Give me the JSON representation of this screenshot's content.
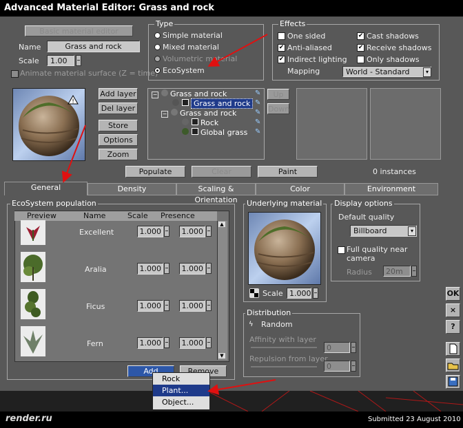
{
  "title": "Advanced Material Editor: Grass and rock",
  "basic_editor_label": "Basic material editor",
  "name_label": "Name",
  "name_value": "Grass and rock",
  "scale_label": "Scale",
  "scale_value": "1.00",
  "animate_label": "Animate material surface (Z = time)",
  "type": {
    "title": "Type",
    "options": [
      "Simple material",
      "Mixed material",
      "Volumetric material",
      "EcoSystem"
    ],
    "selected": 3
  },
  "effects": {
    "title": "Effects",
    "left": [
      "One sided",
      "Anti-aliased",
      "Indirect lighting"
    ],
    "left_checked": [
      true,
      true,
      true
    ],
    "right": [
      "Cast shadows",
      "Receive shadows",
      "Only shadows"
    ],
    "right_checked": [
      true,
      true,
      false
    ],
    "mapping_label": "Mapping",
    "mapping_value": "World - Standard"
  },
  "layer_buttons": [
    "Add layer",
    "Del layer",
    "Store",
    "Options",
    "Zoom"
  ],
  "tree": [
    "Grass and rock",
    "Grass and rock",
    "Grass and rock",
    "Rock",
    "Global grass"
  ],
  "up_label": "Up",
  "down_label": "Down",
  "populate_label": "Populate",
  "clear_label": "Clear",
  "paint_label": "Paint",
  "instances": "0 instances",
  "tabs": [
    "General",
    "Density",
    "Scaling & Orientation",
    "Color",
    "Environment"
  ],
  "eco": {
    "title": "EcoSystem population",
    "headers": [
      "Preview",
      "Name",
      "Scale",
      "Presence"
    ],
    "rows": [
      {
        "name": "Excellent",
        "scale": "1.000",
        "presence": "1.000"
      },
      {
        "name": "Aralia",
        "scale": "1.000",
        "presence": "1.000"
      },
      {
        "name": "Ficus",
        "scale": "1.000",
        "presence": "1.000"
      },
      {
        "name": "Fern",
        "scale": "1.000",
        "presence": "1.000"
      }
    ],
    "add_label": "Add",
    "remove_label": "Remove"
  },
  "underlying": {
    "title": "Underlying material",
    "scale_label": "Scale",
    "scale_value": "1.000"
  },
  "display": {
    "title": "Display options",
    "quality_label": "Default quality",
    "quality_value": "Billboard",
    "full_quality": "Full quality near camera",
    "radius_label": "Radius",
    "radius_value": "20m"
  },
  "distribution": {
    "title": "Distribution",
    "mode": "Random",
    "affinity_label": "Affinity with layer",
    "affinity_value": "0",
    "repulsion_label": "Repulsion from layer",
    "repulsion_value": "0"
  },
  "side": {
    "ok": "OK",
    "close": "×",
    "help": "?"
  },
  "popup": [
    "Rock",
    "Plant...",
    "Object..."
  ],
  "popup_selected": 1,
  "footer": {
    "logo": "render.ru",
    "submitted": "Submitted 23 August 2010"
  },
  "accent": "#1e3a8a",
  "arrow_color": "#e01010"
}
